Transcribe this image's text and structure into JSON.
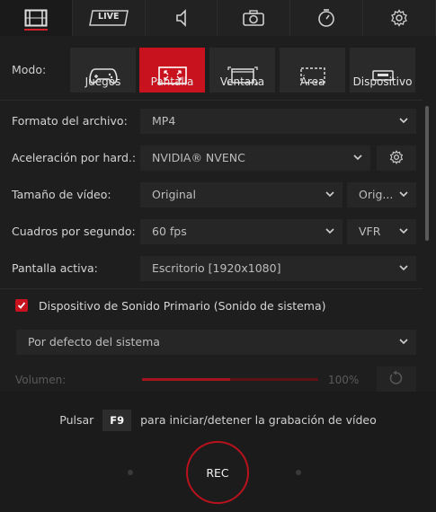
{
  "tabs": [
    {
      "icon": "film-icon",
      "active": true
    },
    {
      "icon": "live-icon",
      "label": "LIVE"
    },
    {
      "icon": "speaker-icon"
    },
    {
      "icon": "camera-icon"
    },
    {
      "icon": "timer-icon"
    },
    {
      "icon": "gear-icon"
    }
  ],
  "mode": {
    "label": "Modo:",
    "buttons": [
      {
        "label": "Juegos",
        "icon": "gamepad-icon"
      },
      {
        "label": "Pantalla",
        "icon": "fullscreen-icon",
        "active": true
      },
      {
        "label": "Ventana",
        "icon": "window-icon"
      },
      {
        "label": "Área",
        "icon": "area-icon"
      },
      {
        "label": "Dispositivo",
        "icon": "device-icon"
      }
    ]
  },
  "settings": {
    "file_format": {
      "label": "Formato del archivo:",
      "value": "MP4"
    },
    "hw_accel": {
      "label": "Aceleración por hard.:",
      "value": "NVIDIA® NVENC"
    },
    "video_size": {
      "label": "Tamaño de vídeo:",
      "value": "Original",
      "value2": "Orig..."
    },
    "fps": {
      "label": "Cuadros por segundo:",
      "value": "60 fps",
      "value2": "VFR"
    },
    "active_screen": {
      "label": "Pantalla activa:",
      "value": "Escritorio [1920x1080]"
    }
  },
  "audio": {
    "primary_checked": true,
    "primary_label": "Dispositivo de Sonido Primario (Sonido de sistema)",
    "device": "Por defecto del sistema",
    "volume_label": "Volumen:",
    "volume_value": "100%",
    "volume_fraction": 0.5
  },
  "record": {
    "hint_prefix": "Pulsar",
    "hotkey": "F9",
    "hint_suffix": "para iniciar/detener la grabación de vídeo",
    "button_label": "REC"
  },
  "colors": {
    "accent": "#c8131f",
    "background": "#1e1e1e"
  }
}
